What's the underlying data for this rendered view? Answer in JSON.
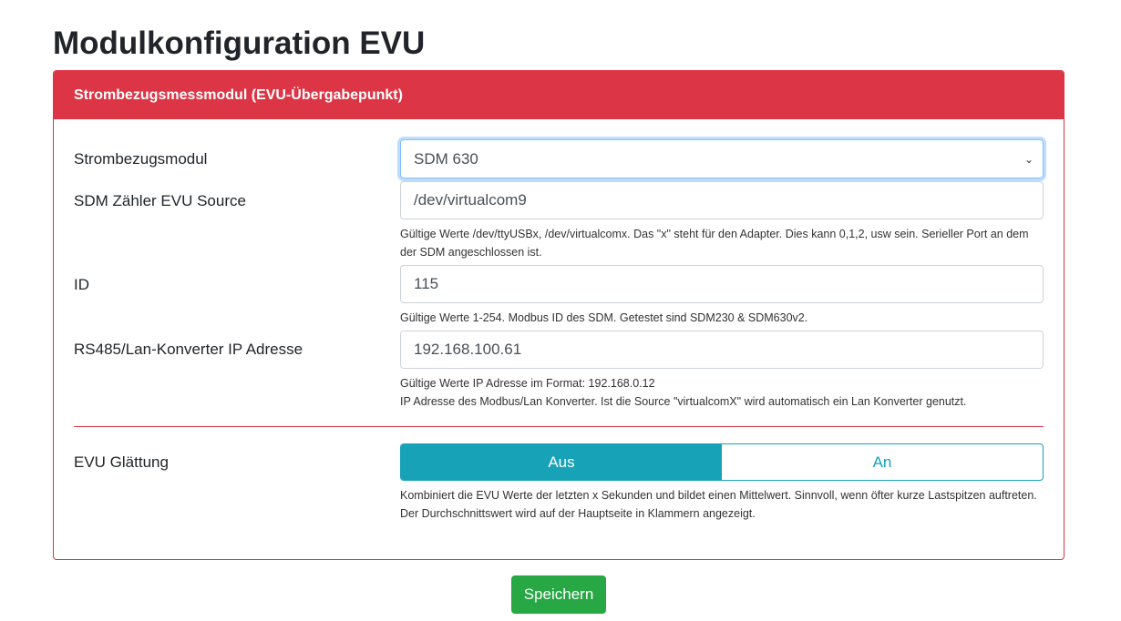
{
  "page_title": "Modulkonfiguration EVU",
  "card": {
    "header": "Strombezugsmessmodul (EVU-Übergabepunkt)",
    "modul": {
      "label": "Strombezugsmodul",
      "value": "SDM 630"
    },
    "source": {
      "label": "SDM Zähler EVU Source",
      "value": "/dev/virtualcom9",
      "help": "Gültige Werte /dev/ttyUSBx, /dev/virtualcomx. Das \"x\" steht für den Adapter. Dies kann 0,1,2, usw sein. Serieller Port an dem der SDM angeschlossen ist."
    },
    "id": {
      "label": "ID",
      "value": "115",
      "help": "Gültige Werte 1-254. Modbus ID des SDM. Getestet sind SDM230 & SDM630v2."
    },
    "ip": {
      "label": "RS485/Lan-Konverter IP Adresse",
      "value": "192.168.100.61",
      "help1": "Gültige Werte IP Adresse im Format: 192.168.0.12",
      "help2": "IP Adresse des Modbus/Lan Konverter. Ist die Source \"virtualcomX\" wird automatisch ein Lan Konverter genutzt."
    },
    "smoothing": {
      "label": "EVU Glättung",
      "off": "Aus",
      "on": "An",
      "selected": "Aus",
      "help": "Kombiniert die EVU Werte der letzten x Sekunden und bildet einen Mittelwert. Sinnvoll, wenn öfter kurze Lastspitzen auftreten. Der Durchschnittswert wird auf der Hauptseite in Klammern angezeigt."
    }
  },
  "save_label": "Speichern"
}
